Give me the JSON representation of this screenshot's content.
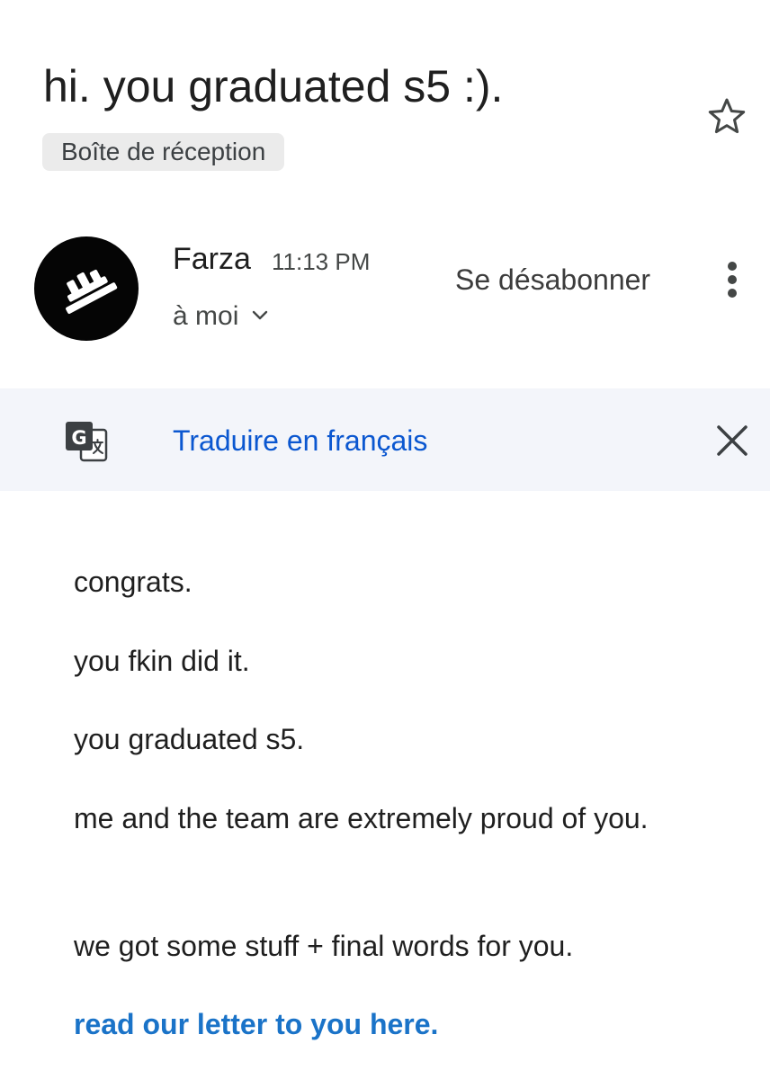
{
  "email": {
    "subject": "hi. you graduated s5 :).",
    "label": "Boîte de réception",
    "sender_name": "Farza",
    "time": "11:13 PM",
    "recipient": "à moi",
    "unsubscribe_label": "Se désabonner"
  },
  "translate": {
    "link_label": "Traduire en français"
  },
  "body": {
    "paragraphs": [
      "congrats.",
      "you fkin did it.",
      "you graduated s5.",
      "me and the team are extremely proud of you.",
      "we got some stuff + final words for you."
    ],
    "link_text": "read our letter to you here."
  },
  "icons": {
    "star": "star-outline-icon",
    "avatar": "sender-logo-avatar",
    "chevron": "chevron-down-icon",
    "more": "more-vertical-icon",
    "translate": "google-translate-icon",
    "close": "close-icon"
  },
  "colors": {
    "link_blue": "#0b57d0",
    "body_link": "#1a73c8",
    "translate_bar_bg": "#f3f5fa",
    "chip_bg": "#ebebeb",
    "avatar_bg": "#050505"
  }
}
